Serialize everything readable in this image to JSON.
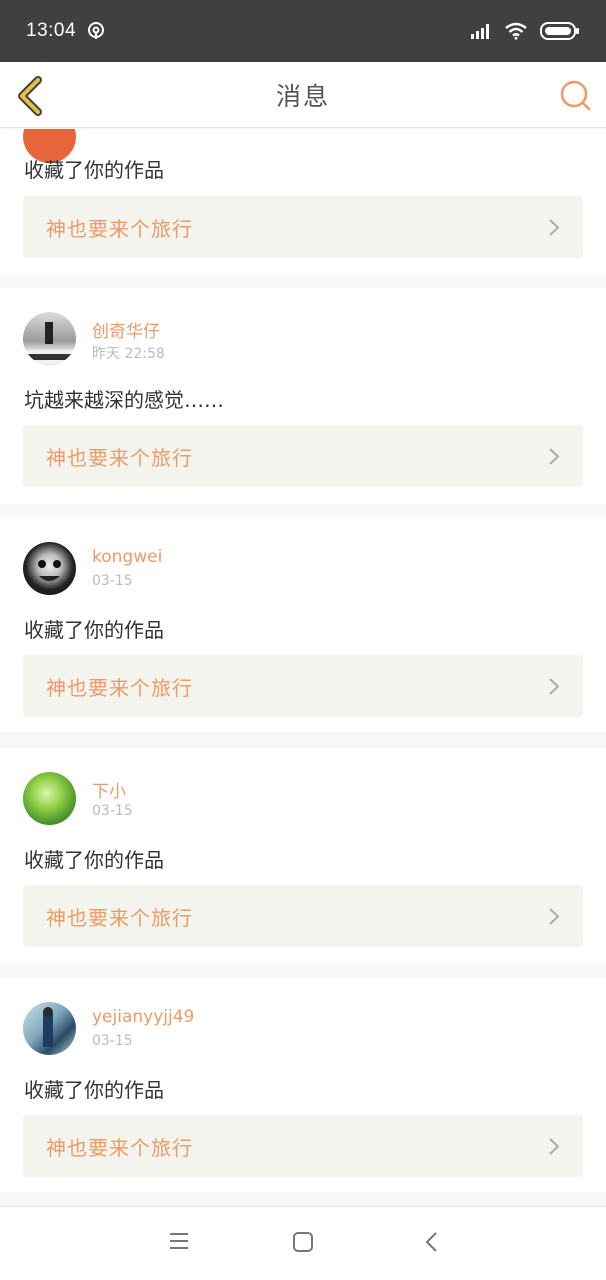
{
  "status_bar": {
    "time": "13:04"
  },
  "header": {
    "title": "消息"
  },
  "feed": {
    "items": [
      {
        "username": "",
        "time": "",
        "message": "收藏了你的作品",
        "work_title": "神也要来个旅行"
      },
      {
        "username": "创奇华仔",
        "time": "昨天 22:58",
        "message": "坑越来越深的感觉……",
        "work_title": "神也要来个旅行"
      },
      {
        "username": "kongwei",
        "time": "03-15",
        "message": "收藏了你的作品",
        "work_title": "神也要来个旅行"
      },
      {
        "username": "下小",
        "time": "03-15",
        "message": "收藏了你的作品",
        "work_title": "神也要来个旅行"
      },
      {
        "username": "yejianyyjj49",
        "time": "03-15",
        "message": "收藏了你的作品",
        "work_title": "神也要来个旅行"
      }
    ]
  },
  "colors": {
    "accent": "#ee9a66",
    "status_bar": "#404040",
    "link_bg": "#f4f4ee",
    "back_icon": "#c9a33a"
  },
  "icons": {
    "back": "back-icon",
    "search": "search-icon",
    "chevron": "chevron-right-icon",
    "nav_menu": "menu-icon",
    "nav_home": "home-icon",
    "nav_back": "system-back-icon"
  }
}
